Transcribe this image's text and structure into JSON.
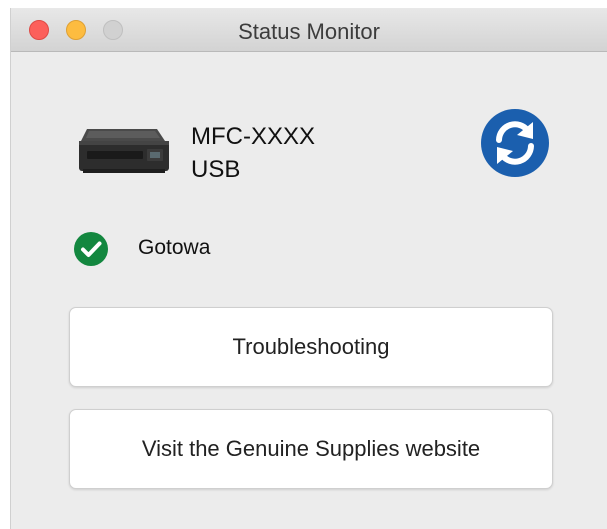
{
  "window": {
    "title": "Status Monitor"
  },
  "device": {
    "name": "MFC-XXXX",
    "connection": "USB",
    "icon": "printer-icon"
  },
  "refresh": {
    "icon": "refresh-icon",
    "color": "#1b5fae"
  },
  "status": {
    "icon": "check-circle-icon",
    "text": "Gotowa",
    "color": "#13873f"
  },
  "buttons": {
    "troubleshooting": "Troubleshooting",
    "supplies": "Visit the Genuine Supplies website"
  }
}
